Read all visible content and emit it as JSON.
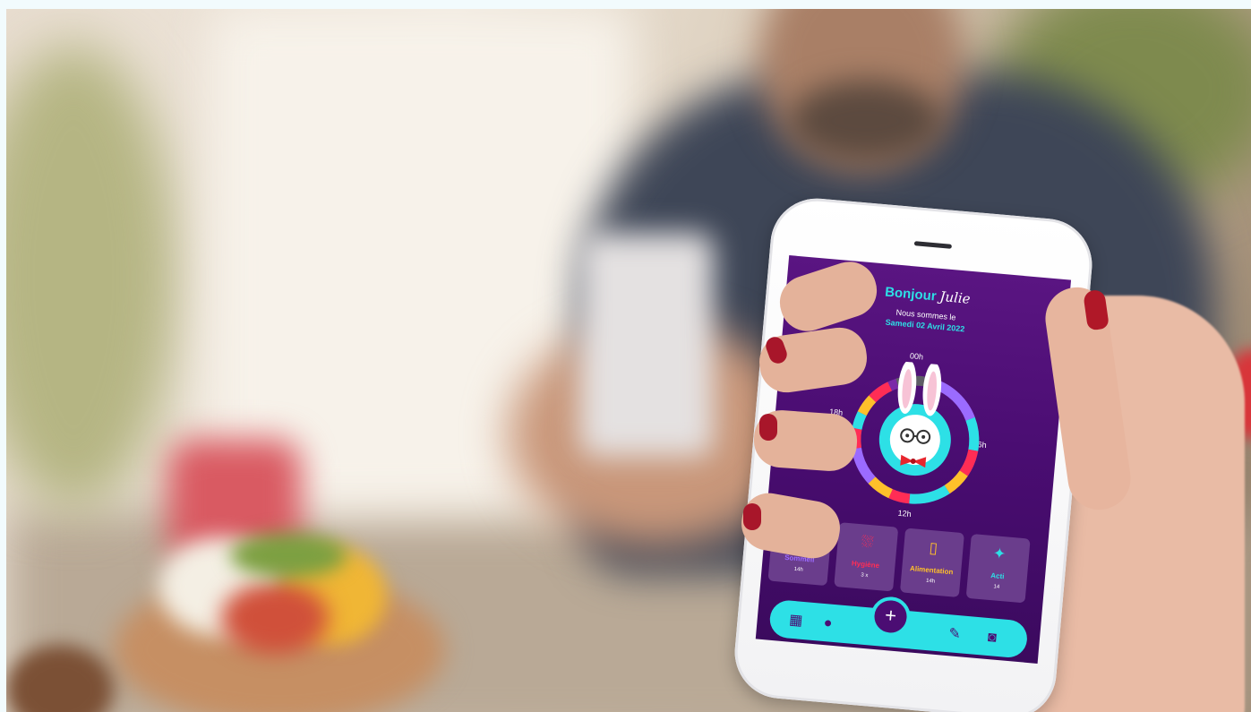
{
  "app": {
    "greeting": "Bonjour",
    "user_name": "Julie",
    "date_intro": "Nous sommes le",
    "date": "Samedi 02 Avril 2022"
  },
  "clock": {
    "labels": {
      "top": "00h",
      "right": "6h",
      "bottom": "12h",
      "left": "18h"
    }
  },
  "categories": [
    {
      "label": "Sommeil",
      "value": "14h",
      "color": "#9b6bff",
      "icon": "baby-carriage-icon"
    },
    {
      "label": "Hygiène",
      "value": "3 x",
      "color": "#ff2d55",
      "icon": "bathtub-icon"
    },
    {
      "label": "Alimentation",
      "value": "14h",
      "color": "#ffc02a",
      "icon": "baby-bottle-icon"
    },
    {
      "label": "Acti",
      "value": "14",
      "color": "#2de0e6",
      "icon": "activity-icon"
    }
  ],
  "nav": {
    "items": [
      "calendar-icon",
      "profile-icon",
      "add-icon",
      "pencil-icon",
      "camera-icon"
    ]
  },
  "colors": {
    "accent": "#2de0e6",
    "screen_bg": "#4b0d73",
    "sleep": "#9b6bff",
    "hygiene": "#ff2d55",
    "food": "#ffc02a"
  }
}
